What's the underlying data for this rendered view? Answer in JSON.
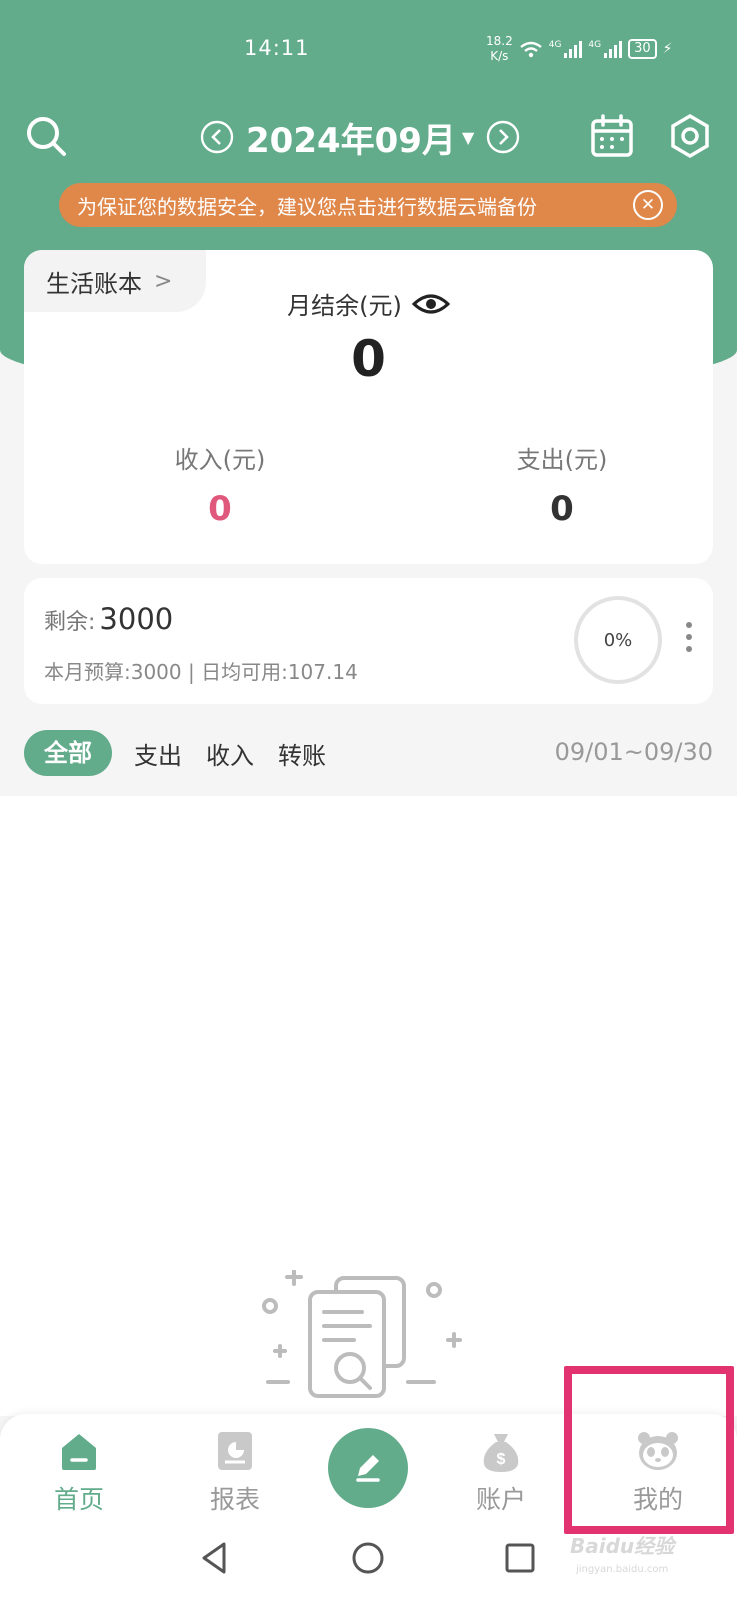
{
  "status_bar": {
    "time": "14:11",
    "net_speed_value": "18.2",
    "net_speed_unit": "K/s",
    "signal_label_1": "4G",
    "signal_label_2": "4G",
    "battery": "30"
  },
  "header": {
    "month_title": "2024年09月",
    "backup_banner": "为保证您的数据安全，建议您点击进行数据云端备份",
    "brand_color": "#62ac8b",
    "banner_color": "#e0874a"
  },
  "summary": {
    "book_name": "生活账本",
    "balance_label": "月结余(元)",
    "balance_value": "0",
    "income_label": "收入(元)",
    "income_value": "0",
    "expense_label": "支出(元)",
    "expense_value": "0"
  },
  "budget": {
    "remain_label": "剩余:",
    "remain_value": "3000",
    "detail": "本月预算:3000 | 日均可用:107.14",
    "percent": "0%"
  },
  "filter": {
    "tabs": [
      "全部",
      "支出",
      "收入",
      "转账"
    ],
    "active_tab": "全部",
    "date_range": "09/01~09/30"
  },
  "bottom_nav": {
    "items": [
      {
        "label": "首页",
        "icon": "home-icon",
        "active": true
      },
      {
        "label": "报表",
        "icon": "report-icon",
        "active": false
      },
      {
        "label": "",
        "icon": "edit-pen-icon",
        "active": false
      },
      {
        "label": "账户",
        "icon": "money-bag-icon",
        "active": false
      },
      {
        "label": "我的",
        "icon": "panda-avatar-icon",
        "active": false
      }
    ]
  },
  "watermark": {
    "text": "Baidu经验",
    "sub": "jingyan.baidu.com"
  },
  "highlight_color": "#e23270"
}
